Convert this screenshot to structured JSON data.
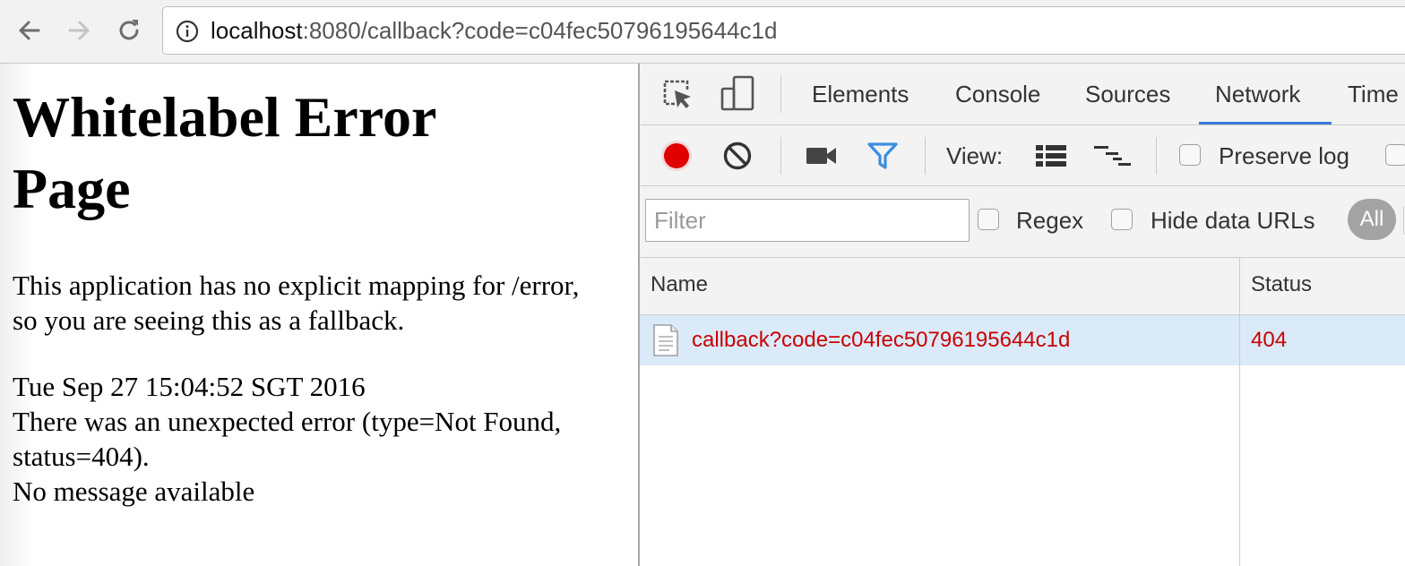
{
  "browser": {
    "back_icon": "arrow-left-icon",
    "forward_icon": "arrow-right-icon",
    "reload_icon": "reload-icon",
    "info_icon": "info-circle-icon",
    "url_host": "localhost",
    "url_rest": ":8080/callback?code=c04fec50796195644c1d"
  },
  "page": {
    "title": "Whitelabel Error Page",
    "message": "This application has no explicit mapping for /error, so you are seeing this as a fallback.",
    "timestamp": "Tue Sep 27 15:04:52 SGT 2016",
    "error_line": "There was an unexpected error (type=Not Found, status=404).",
    "detail": "No message available"
  },
  "devtools": {
    "tabs": [
      {
        "label": "Elements"
      },
      {
        "label": "Console"
      },
      {
        "label": "Sources"
      },
      {
        "label": "Network",
        "active": true
      },
      {
        "label": "Time"
      }
    ],
    "controls": {
      "view_label": "View:",
      "preserve_log_label": "Preserve log"
    },
    "filter": {
      "placeholder": "Filter",
      "regex_label": "Regex",
      "hide_data_urls_label": "Hide data URLs",
      "all_label": "All"
    },
    "table": {
      "columns": [
        "Name",
        "Status"
      ],
      "rows": [
        {
          "name": "callback?code=c04fec50796195644c1d",
          "status": "404"
        }
      ]
    },
    "colors": {
      "record_red": "#e00000",
      "error_text": "#c80000",
      "active_tab_underline": "#3879d9",
      "filter_icon": "#3b8de0",
      "selected_row": "#dbeaf9"
    }
  }
}
